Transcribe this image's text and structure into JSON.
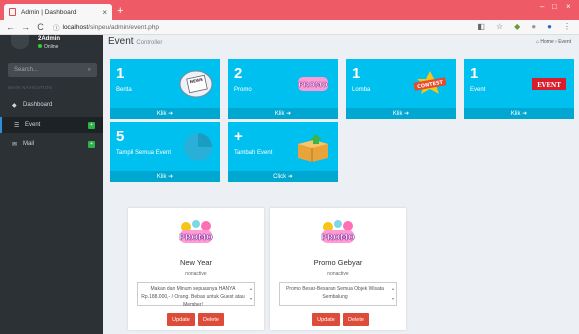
{
  "browser": {
    "tab_title": "Admin | Dashboard",
    "tab_close": "×",
    "new_tab": "+",
    "url_host": "localhost",
    "url_path": "/sinpeu/admin/event.php",
    "nav_back": "←",
    "nav_forward": "→",
    "nav_reload": "C",
    "info_icon": "ⓘ",
    "win_min": "–",
    "win_max": "□",
    "win_close": "×"
  },
  "sidebar": {
    "user_name": "2Admin",
    "user_status": "Online",
    "search_placeholder": "Search...",
    "search_icon": "⌕",
    "nav_header": "MAIN NAVIGATION",
    "items": [
      {
        "label": "Dashboard",
        "icon": "dashboard-icon",
        "glyph": "◆"
      },
      {
        "label": "Event",
        "icon": "list-icon",
        "glyph": "☰",
        "badge": "+"
      },
      {
        "label": "Mail",
        "icon": "mail-icon",
        "glyph": "✉",
        "badge": "+"
      }
    ]
  },
  "page": {
    "title": "Event",
    "subtitle": "Controller",
    "breadcrumb_home": "Home",
    "breadcrumb_current": "Event"
  },
  "boxes": [
    {
      "num": "1",
      "label": "Berita",
      "footer": "Klik ➜"
    },
    {
      "num": "2",
      "label": "Promo",
      "footer": "Klik ➜"
    },
    {
      "num": "1",
      "label": "Lomba",
      "footer": "Klik ➜"
    },
    {
      "num": "1",
      "label": "Event",
      "footer": "Klik ➜"
    },
    {
      "num": "5",
      "label": "Tampil Semua Event",
      "footer": "Klik ➜"
    },
    {
      "num": "+",
      "label": "Tambah Event",
      "footer": "Click ➜"
    }
  ],
  "box_images": {
    "news": "NEWS",
    "promo": "PROMO",
    "contest": "CONTEST",
    "event": "EVENT"
  },
  "cards": [
    {
      "logo": "PROMO",
      "title": "New Year",
      "status": "nonactive",
      "description": "Makan dan Minum sepuasnya HANYA Rp.188.000,- / Orang. Bebas untuk Guest atau Member!",
      "update": "Update",
      "delete": "Delete"
    },
    {
      "logo": "PROMO",
      "title": "Promo Gebyar",
      "status": "nonactive",
      "description": "Promo Besar-Besaran Semua Objek Wisata Sembalung",
      "update": "Update",
      "delete": "Delete"
    }
  ],
  "colors": {
    "chrome_red": "#ee5b66",
    "info_box": "#00c0ef",
    "sidebar": "#2b3135",
    "danger": "#dd4b39",
    "badge_green": "#2db24a"
  }
}
